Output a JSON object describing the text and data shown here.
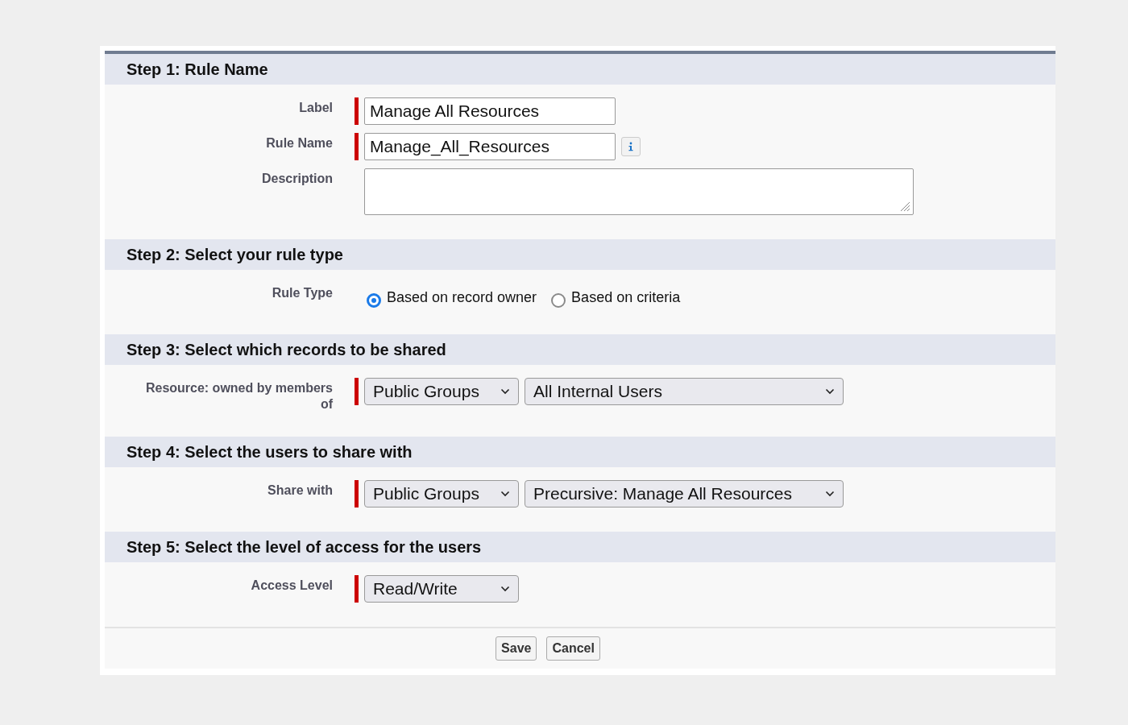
{
  "steps": [
    {
      "title": "Step 1: Rule Name",
      "fields": [
        {
          "kind": "text",
          "label": "Label",
          "required": true,
          "value": "Manage All Resources"
        },
        {
          "kind": "text",
          "label": "Rule Name",
          "required": true,
          "value": "Manage_All_Resources",
          "info": true
        },
        {
          "kind": "textarea",
          "label": "Description"
        }
      ]
    },
    {
      "title": "Step 2: Select your rule type",
      "fields": [
        {
          "kind": "radio",
          "label": "Rule Type",
          "options": [
            {
              "label": "Based on record owner",
              "selected": true
            },
            {
              "label": "Based on criteria",
              "selected": false
            }
          ]
        }
      ]
    },
    {
      "title": "Step 3: Select which records to be shared",
      "fields": [
        {
          "kind": "selects",
          "label": "Resource: owned by members of",
          "required": true,
          "selects": [
            {
              "value": "Public Groups",
              "wide": false
            },
            {
              "value": "All Internal Users",
              "wide": true
            }
          ]
        }
      ]
    },
    {
      "title": "Step 4: Select the users to share with",
      "fields": [
        {
          "kind": "selects",
          "label": "Share with",
          "required": true,
          "selects": [
            {
              "value": "Public Groups",
              "wide": false
            },
            {
              "value": "Precursive: Manage All Resources",
              "wide": true
            }
          ]
        }
      ]
    },
    {
      "title": "Step 5: Select the level of access for the users",
      "fields": [
        {
          "kind": "selects",
          "label": "Access Level",
          "required": true,
          "selects": [
            {
              "value": "Read/Write",
              "wide": false
            }
          ]
        }
      ]
    }
  ],
  "buttons": [
    "Save",
    "Cancel"
  ]
}
